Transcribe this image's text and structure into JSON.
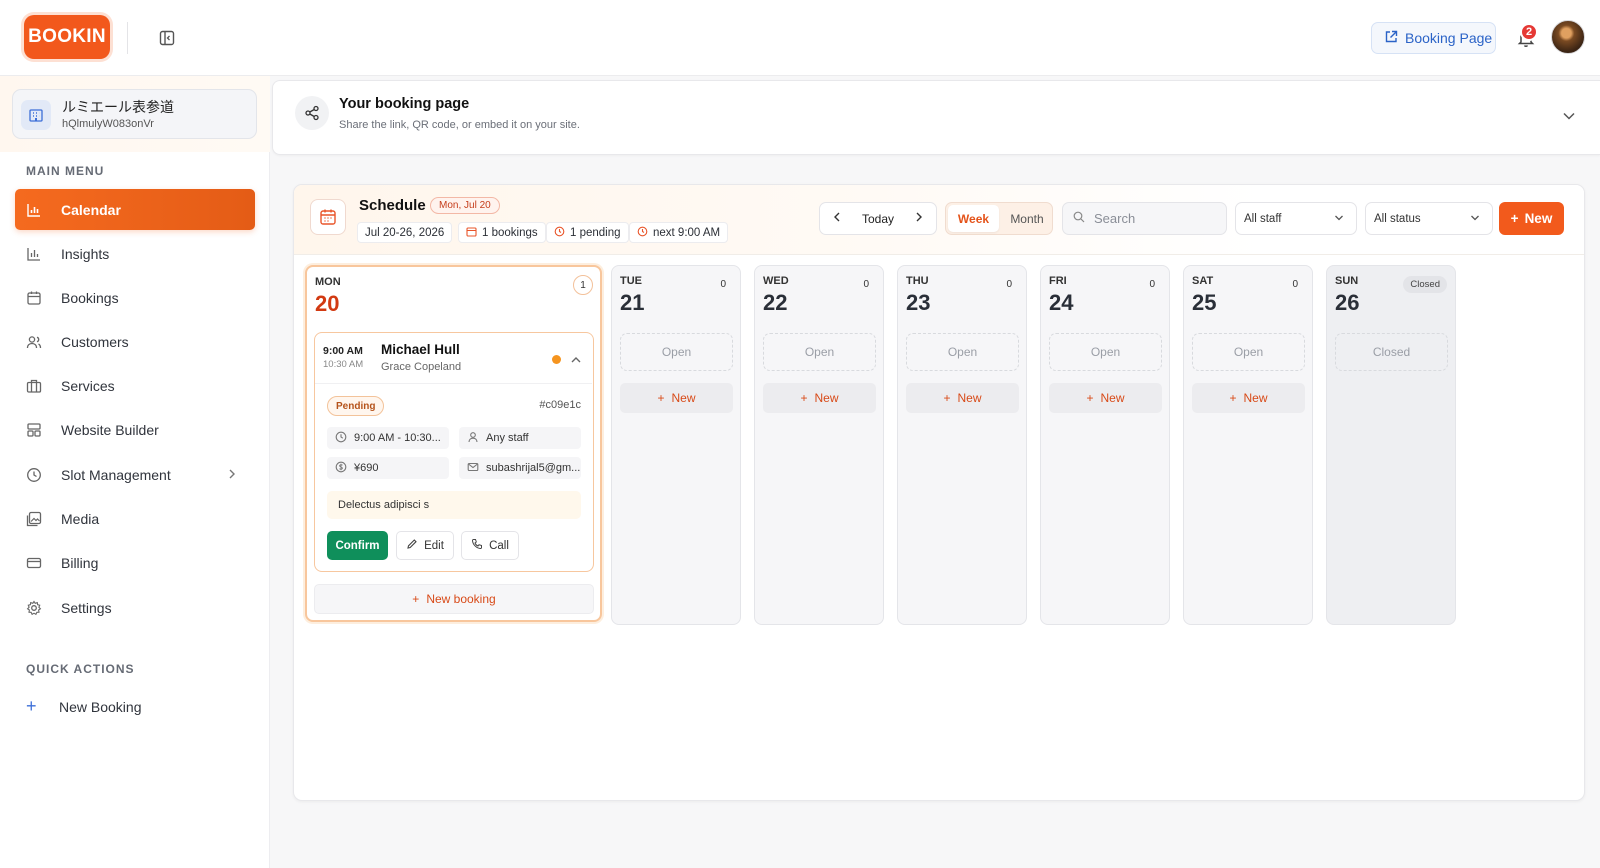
{
  "header": {
    "logo_text": "BOOKIN",
    "booking_page_label": "Booking Page",
    "notification_count": "2"
  },
  "sidebar": {
    "org": {
      "name": "ルミエール表参道",
      "id": "hQlmulyW083onVr"
    },
    "main_menu_label": "MAIN MENU",
    "items": [
      {
        "label": "Calendar",
        "icon": "bar-chart-icon"
      },
      {
        "label": "Insights",
        "icon": "insights-icon"
      },
      {
        "label": "Bookings",
        "icon": "calendar-icon"
      },
      {
        "label": "Customers",
        "icon": "users-icon"
      },
      {
        "label": "Services",
        "icon": "briefcase-icon"
      },
      {
        "label": "Website Builder",
        "icon": "layout-icon"
      },
      {
        "label": "Slot Management",
        "icon": "clock-icon"
      },
      {
        "label": "Media",
        "icon": "image-icon"
      },
      {
        "label": "Billing",
        "icon": "credit-card-icon"
      },
      {
        "label": "Settings",
        "icon": "gear-icon"
      }
    ],
    "quick_actions_label": "QUICK ACTIONS",
    "quick_actions": [
      {
        "label": "New Booking"
      }
    ]
  },
  "booking_page_card": {
    "title": "Your booking page",
    "subtitle": "Share the link, QR code, or embed it on your site."
  },
  "schedule": {
    "title": "Schedule",
    "date_badge": "Mon, Jul 20",
    "range": "Jul 20-26, 2026",
    "bookings_count": "1 bookings",
    "pending_count": "1 pending",
    "next_label": "next 9:00 AM",
    "today_label": "Today",
    "views": {
      "week": "Week",
      "month": "Month"
    },
    "search_placeholder": "Search",
    "staff_filter": "All staff",
    "status_filter": "All status",
    "new_label": "New",
    "days": [
      {
        "name": "MON",
        "num": "20",
        "count": "1"
      },
      {
        "name": "TUE",
        "num": "21",
        "count": "0",
        "slot": "Open",
        "add": "New"
      },
      {
        "name": "WED",
        "num": "22",
        "count": "0",
        "slot": "Open",
        "add": "New"
      },
      {
        "name": "THU",
        "num": "23",
        "count": "0",
        "slot": "Open",
        "add": "New"
      },
      {
        "name": "FRI",
        "num": "24",
        "count": "0",
        "slot": "Open",
        "add": "New"
      },
      {
        "name": "SAT",
        "num": "25",
        "count": "0",
        "slot": "Open",
        "add": "New"
      },
      {
        "name": "SUN",
        "num": "26",
        "count": "Closed",
        "slot": "Closed"
      }
    ],
    "booking": {
      "start": "9:00 AM",
      "end": "10:30 AM",
      "customer": "Michael Hull",
      "staff": "Grace Copeland",
      "status": "Pending",
      "id": "#c09e1c",
      "time_range": "9:00 AM - 10:30...",
      "staff_chip": "Any staff",
      "price": "¥690",
      "email": "subashrijal5@gm...",
      "note": "Delectus adipisci s",
      "confirm_label": "Confirm",
      "edit_label": "Edit",
      "call_label": "Call",
      "new_booking_label": "New booking"
    }
  }
}
